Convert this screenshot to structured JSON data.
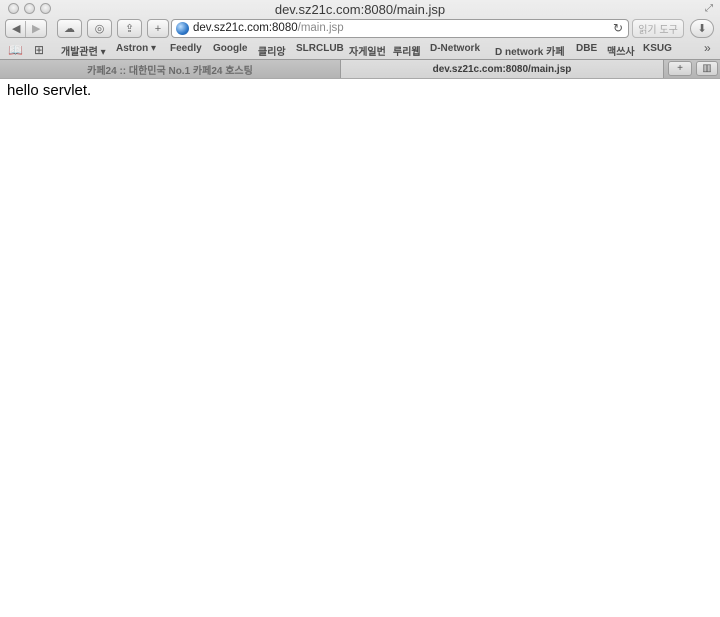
{
  "window": {
    "title": "dev.sz21c.com:8080/main.jsp"
  },
  "toolbar": {
    "back_icon": "◀",
    "forward_icon": "▶",
    "address": {
      "host": "dev.sz21c.com:8080",
      "path": "/main.jsp"
    },
    "reader_label": "읽기 도구"
  },
  "bookmarks": [
    {
      "label": "개발관련 ▾"
    },
    {
      "label": "Astron ▾"
    },
    {
      "label": "Feedly"
    },
    {
      "label": "Google"
    },
    {
      "label": "클리앙"
    },
    {
      "label": "SLRCLUB"
    },
    {
      "label": "자게일번"
    },
    {
      "label": "루리웹"
    },
    {
      "label": "D-Network"
    },
    {
      "label": "D network 카페"
    },
    {
      "label": "DBE"
    },
    {
      "label": "맥쓰사"
    },
    {
      "label": "KSUG"
    }
  ],
  "tabs": [
    {
      "label": "카페24 :: 대한민국 No.1 카페24 호스팅",
      "active": false
    },
    {
      "label": "dev.sz21c.com:8080/main.jsp",
      "active": true
    }
  ],
  "page": {
    "body_text": "hello servlet."
  }
}
